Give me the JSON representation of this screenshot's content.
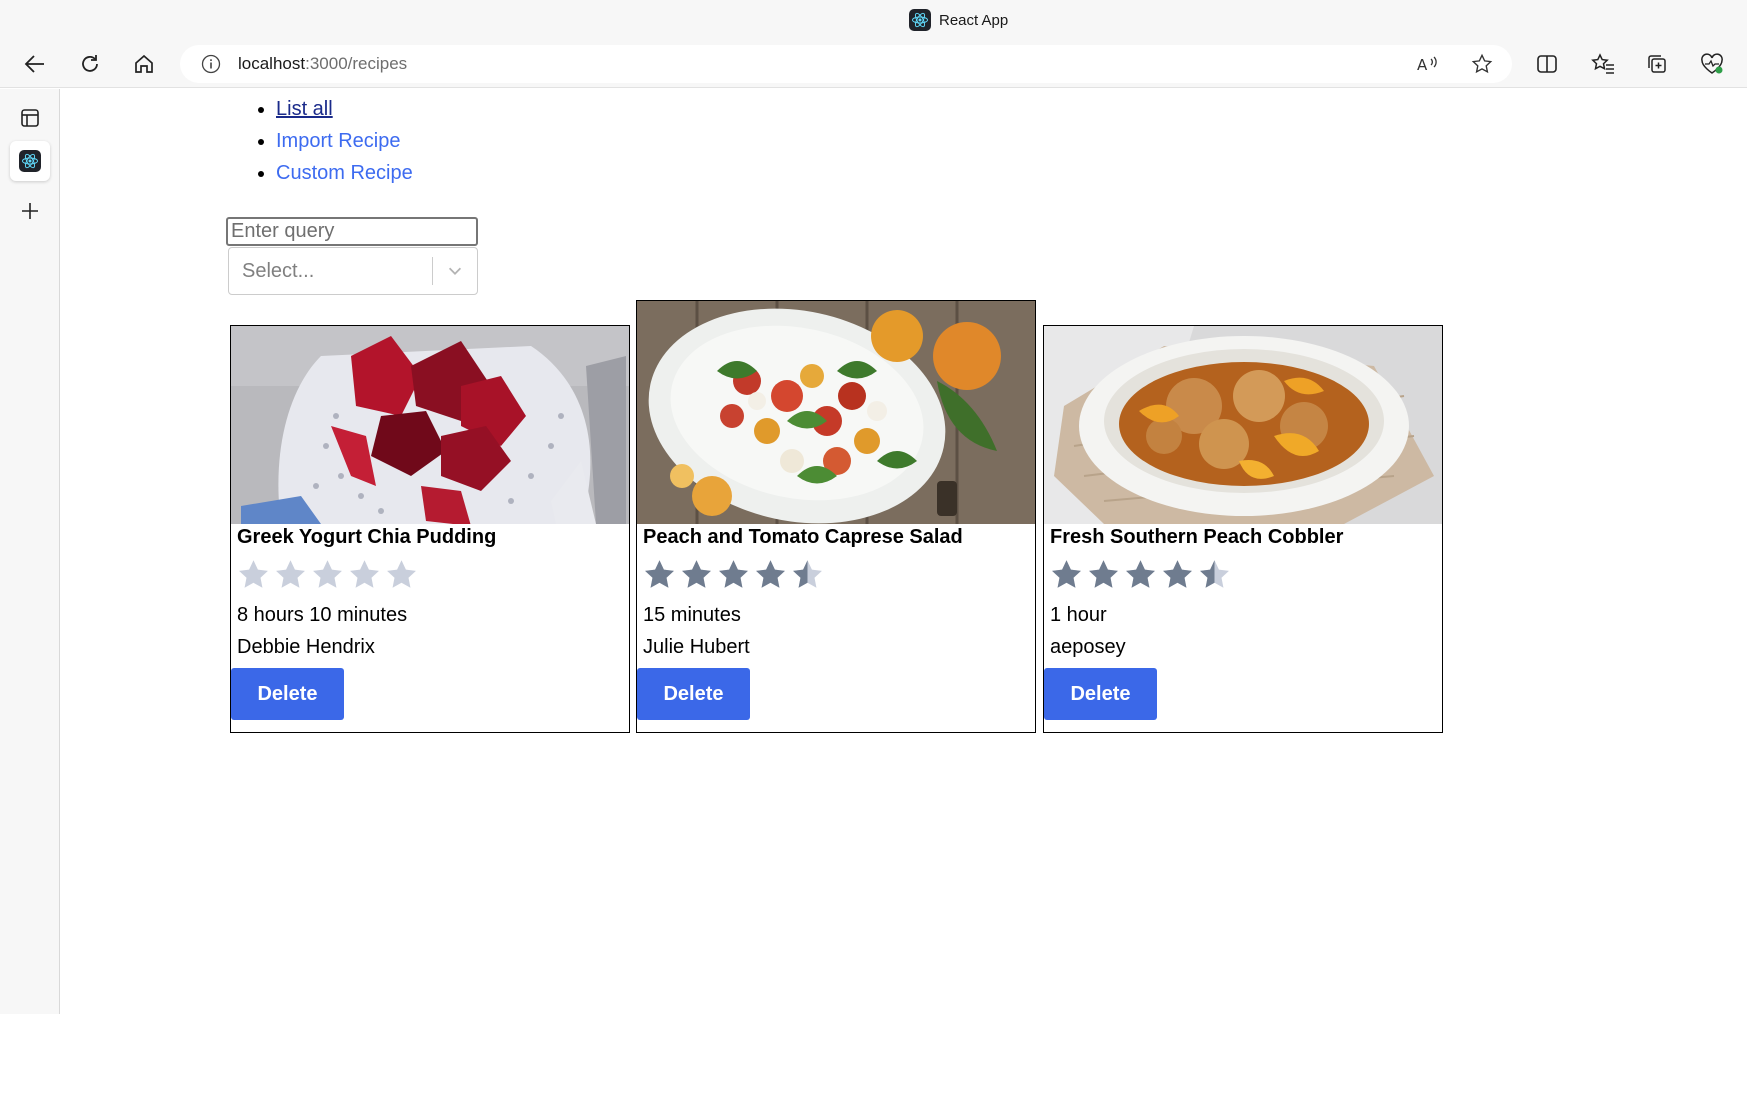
{
  "browser": {
    "tab_title": "React App",
    "address": {
      "host": "localhost",
      "path": ":3000/recipes"
    }
  },
  "nav": {
    "items": [
      {
        "label": "List all",
        "current": true
      },
      {
        "label": "Import Recipe",
        "current": false
      },
      {
        "label": "Custom Recipe",
        "current": false
      }
    ]
  },
  "search": {
    "placeholder": "Enter query",
    "value": ""
  },
  "select": {
    "placeholder": "Select..."
  },
  "recipes": [
    {
      "title": "Greek Yogurt Chia Pudding",
      "rating": 0,
      "time": "8 hours 10 minutes",
      "author": "Debbie Hendrix",
      "delete_label": "Delete",
      "image": "strawberry-chia-pudding"
    },
    {
      "title": "Peach and Tomato Caprese Salad",
      "rating": 4.5,
      "time": "15 minutes",
      "author": "Julie Hubert",
      "delete_label": "Delete",
      "image": "peach-tomato-salad"
    },
    {
      "title": "Fresh Southern Peach Cobbler",
      "rating": 4.5,
      "time": "1 hour",
      "author": "aeposey",
      "delete_label": "Delete",
      "image": "peach-cobbler"
    }
  ],
  "colors": {
    "accent": "#3b68e8",
    "link": "#3d6bf0",
    "star_filled": "#6f7c8f",
    "star_empty": "#c9cfdc"
  }
}
